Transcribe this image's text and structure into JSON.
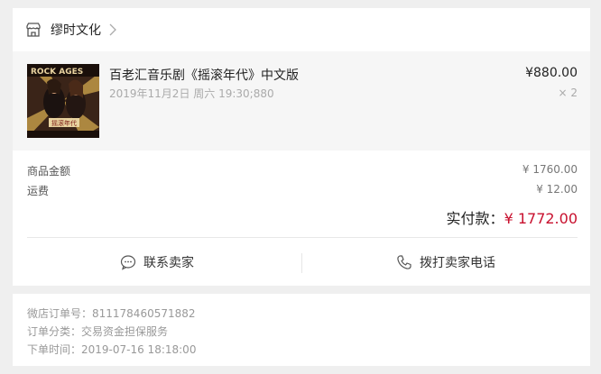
{
  "shop": {
    "name": "缪时文化"
  },
  "item": {
    "title": "百老汇音乐剧《摇滚年代》中文版",
    "subtitle": "2019年11月2日 周六 19:30;880",
    "price": "¥880.00",
    "qty": "× 2",
    "poster_text_top": "ROCK AGES",
    "poster_text_mid": "摇滚年代"
  },
  "summary": {
    "goods_label": "商品金额",
    "goods_value": "¥ 1760.00",
    "ship_label": "运费",
    "ship_value": "¥ 12.00",
    "paid_label": "实付款：",
    "paid_value": "¥ 1772.00"
  },
  "actions": {
    "contact": "联系卖家",
    "call": "拨打卖家电话"
  },
  "order": {
    "number": "微店订单号：811178460571882",
    "category": "订单分类：交易资金担保服务",
    "time": "下单时间：2019-07-16 18:18:00"
  },
  "colors": {
    "accent_red": "#c8102e",
    "background": "#efefef"
  }
}
